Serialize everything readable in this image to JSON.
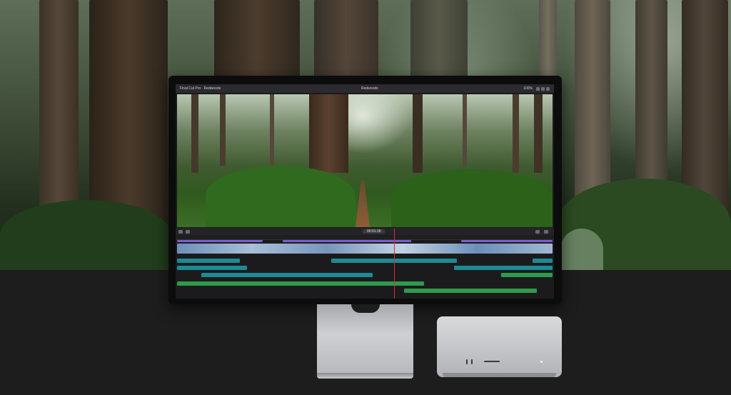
{
  "app": {
    "library_label": "Final Cut Pro · Redwoods",
    "project_label": "Redwoods",
    "zoom_label": "100%",
    "timecode": "00:01:18"
  },
  "colors": {
    "floor": "#1d1d1d",
    "timeline_purple": "#7a5fd0",
    "timeline_teal": "#1e8a92",
    "timeline_green": "#2f9a4a",
    "playhead": "#e02b2b"
  },
  "icons": [
    "window-controls-icon",
    "tool-icon",
    "playhead-icon"
  ]
}
